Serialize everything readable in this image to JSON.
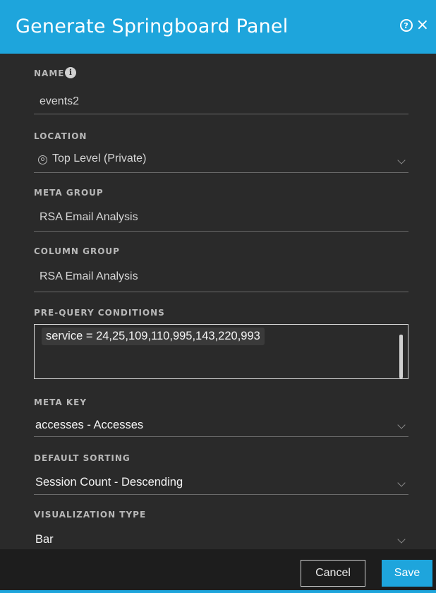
{
  "dialog": {
    "title": "Generate Springboard Panel"
  },
  "fields": {
    "name": {
      "label": "NAME",
      "value": "events2"
    },
    "location": {
      "label": "LOCATION",
      "value": "Top Level (Private)"
    },
    "meta_group": {
      "label": "META GROUP",
      "value": "RSA Email Analysis"
    },
    "column_group": {
      "label": "COLUMN GROUP",
      "value": "RSA Email Analysis"
    },
    "pre_query": {
      "label": "PRE-QUERY CONDITIONS",
      "value": "service = 24,25,109,110,995,143,220,993"
    },
    "meta_key": {
      "label": "META KEY",
      "value": "accesses - Accesses"
    },
    "default_sorting": {
      "label": "DEFAULT SORTING",
      "value": "Session Count - Descending"
    },
    "visualization_type": {
      "label": "VISUALIZATION TYPE",
      "value": "Bar"
    }
  },
  "footer": {
    "cancel_label": "Cancel",
    "save_label": "Save"
  },
  "colors": {
    "accent": "#1ea5dc",
    "background": "#2a2a2a"
  }
}
